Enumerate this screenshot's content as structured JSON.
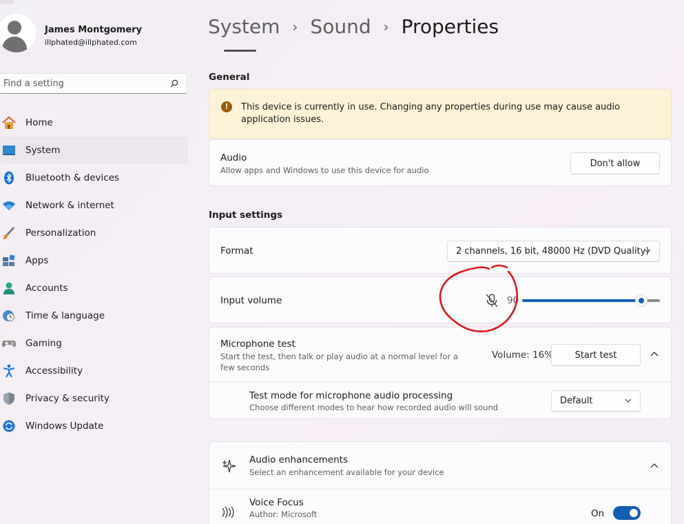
{
  "user": {
    "name": "James Montgomery",
    "email": "illphated@illphated.com"
  },
  "search": {
    "placeholder": "Find a setting"
  },
  "nav": [
    {
      "label": "Home",
      "icon": "home-icon"
    },
    {
      "label": "System",
      "icon": "system-icon",
      "active": true
    },
    {
      "label": "Bluetooth & devices",
      "icon": "bluetooth-icon"
    },
    {
      "label": "Network & internet",
      "icon": "wifi-icon"
    },
    {
      "label": "Personalization",
      "icon": "brush-icon"
    },
    {
      "label": "Apps",
      "icon": "apps-icon"
    },
    {
      "label": "Accounts",
      "icon": "accounts-icon"
    },
    {
      "label": "Time & language",
      "icon": "globe-clock-icon"
    },
    {
      "label": "Gaming",
      "icon": "gamepad-icon"
    },
    {
      "label": "Accessibility",
      "icon": "accessibility-icon"
    },
    {
      "label": "Privacy & security",
      "icon": "shield-icon"
    },
    {
      "label": "Windows Update",
      "icon": "update-icon"
    }
  ],
  "breadcrumb": {
    "items": [
      "System",
      "Sound"
    ],
    "separator": "›",
    "current": "Properties"
  },
  "general": {
    "title": "General",
    "warning": "This device is currently in use. Changing any properties during use may cause audio application issues.",
    "audio": {
      "label": "Audio",
      "desc": "Allow apps and Windows to use this device for audio",
      "button": "Don't allow"
    }
  },
  "input": {
    "title": "Input settings",
    "format": {
      "label": "Format",
      "value": "2 channels, 16 bit, 48000 Hz (DVD Quality)"
    },
    "volume": {
      "label": "Input volume",
      "value": "90",
      "level_percent": 90,
      "muted_icon": "mic-off-icon"
    },
    "mic_test": {
      "label": "Microphone test",
      "desc": "Start the test, then talk or play audio at a normal level for a few seconds",
      "volume_text": "Volume: 16%",
      "button": "Start test"
    },
    "test_mode": {
      "label": "Test mode for microphone audio processing",
      "desc": "Choose different modes to hear how recorded audio will sound",
      "value": "Default"
    }
  },
  "enhancements": {
    "label": "Audio enhancements",
    "desc": "Select an enhancement available for your device",
    "voice_focus": {
      "label": "Voice Focus",
      "author": "Author: Microsoft",
      "state": "On"
    }
  },
  "colors": {
    "accent": "#0f5fb4",
    "annotation": "#e0161b",
    "warning_bg": "#fcf3d6"
  }
}
